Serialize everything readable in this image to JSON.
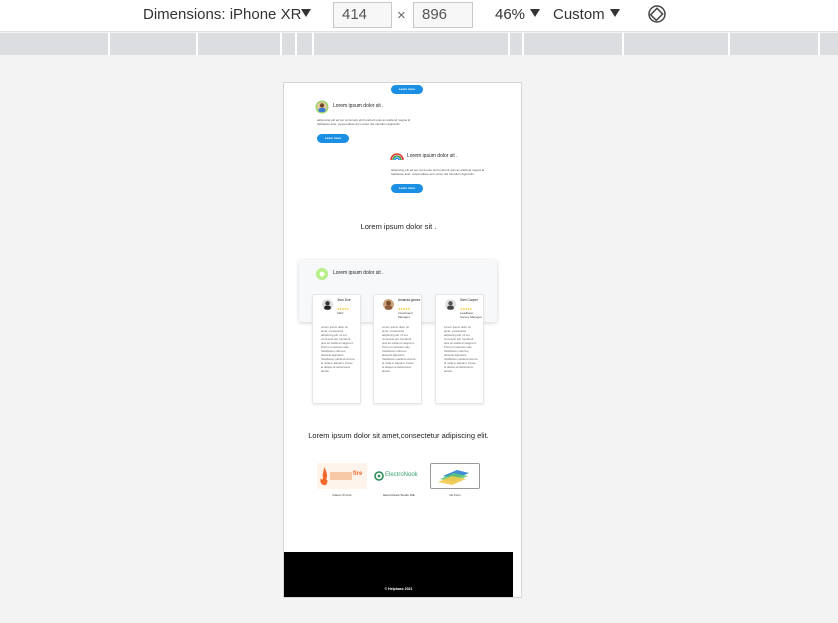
{
  "devtools": {
    "dimensions_label": "Dimensions: iPhone XR",
    "width_value": "414",
    "height_value": "896",
    "times": "×",
    "zoom": "46%",
    "throttle": "Custom"
  },
  "page": {
    "top_button": "Learn more",
    "testimonial_1": {
      "title": "Lorem ipsum dolor sit .",
      "body": "adipiscing elit ed sut commodo elit hendrerit quis ac eleifend magna id habitasse anle. suspendisse arcu amet nisl interdum dignissim.",
      "button": "Learn more"
    },
    "testimonial_2": {
      "title": "Lorem ipsum dolor sit .",
      "body": "adipiscing elit ed sut commodo elit hendrerit quis ac eleifend magna id habitasse anle. suspendisse arcu amet nisl interdum dignissim.",
      "button": "Learn more"
    },
    "section_title": "Lorem ipsum dolor sit .",
    "team_panel_title": "Lorem ipsum dolor sit .",
    "team": [
      {
        "name": "Jhon Doe",
        "stars": "★★★★★",
        "role": "CEO",
        "text": "Lorem ipsum dolor sit amet, consectetur adipiscing elit. Ut sut commodo elit. hendrerit quis ac eleifend magna id. Proin et maximus odio. Vestibulum odio leo, placerat dignissim. Vestibulum eleifend viverra at nulla in aliquam. Fusce et aliquet at tellus lacus iaculis."
      },
      {
        "name": "Amanda gomez",
        "stars": "★★★★★",
        "role": "Investment Manager",
        "text": "Lorem ipsum dolor sit amet, consectetur adipiscing elit. Ut sut commodo elit. hendrerit quis ac eleifend magna id. Proin et maximus odio. Vestibulum odio leo, placerat dignissim. Vestibulum eleifend viverra at nulla in aliquam. Fusce et aliquet at tellus lacus iaculis."
      },
      {
        "name": "Sam Cooper",
        "stars": "★★★★★",
        "role": "Loadbase Survey Manager",
        "text": "Lorem ipsum dolor sit amet, consectetur adipiscing elit. Ut sut commodo elit. hendrerit quis ac eleifend magna id. Proin et maximus odio. Vestibulum odio leo, placerat dignissim. Vestibulum eleifend viverra at nulla in aliquam. Fusce et aliquet at tellus lacus iaculis."
      }
    ],
    "partners_title": "Lorem ipsum dolor sit amet,consectetur adipiscing elit.",
    "partners": [
      {
        "logo_text": "fire",
        "caption": "Flame On Fire"
      },
      {
        "logo_text": "ElectroNook",
        "caption": "ElectroNook Studio IDE"
      },
      {
        "logo_text": "",
        "caption": "1st Form"
      }
    ],
    "footer_text": "© Helpbase 2021"
  },
  "colors": {
    "accent": "#1a8fe3",
    "footer": "#000000",
    "star": "#f1b600"
  }
}
